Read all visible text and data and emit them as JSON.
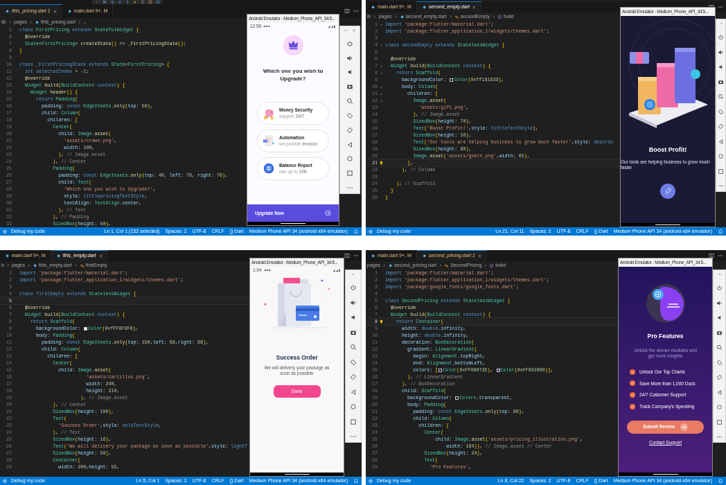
{
  "rows": [
    {
      "panels": [
        {
          "debug_toolbar": true,
          "tabs": [
            {
              "label": "firts_pricing.dart 1",
              "selected": true,
              "warning": true
            },
            {
              "label": "main.dart 9+, M",
              "selected": false,
              "warning": true
            }
          ],
          "breadcrumb": [
            {
              "label": "lib",
              "kind": "folder"
            },
            {
              "label": "pages",
              "kind": "folder"
            },
            {
              "label": "firts_pricing.dart",
              "kind": "file"
            },
            {
              "label": "...",
              "kind": "text"
            }
          ],
          "lines": [
            {
              "n": "5",
              "current": false,
              "text": "class FirstPricing extends StatefulWidget {"
            },
            {
              "n": "6",
              "current": false,
              "text": "  @override"
            },
            {
              "n": "7",
              "current": false,
              "text": "  State<FirstPricing> createState() => _FirstPricingState();"
            },
            {
              "n": "8",
              "current": false,
              "text": "}"
            },
            {
              "n": "9",
              "current": false
            },
            {
              "n": "10",
              "current": false,
              "text": "class _FirstPricingState extends State<FirstPricing> {"
            },
            {
              "n": "11",
              "current": false,
              "text": "  int selectedIndex = -1;"
            },
            {
              "n": "12",
              "current": false,
              "text": "  @override"
            },
            {
              "n": "13",
              "current": false,
              "text": "  Widget build(BuildContext context) {"
            },
            {
              "n": "14",
              "current": false,
              "text": "    Widget header() {"
            },
            {
              "n": "15",
              "current": false,
              "text": "      return Padding("
            },
            {
              "n": "16",
              "current": false,
              "text": "        padding: const EdgeInsets.only(top: 50),"
            },
            {
              "n": "17",
              "current": false,
              "text": "        child: Column("
            },
            {
              "n": "18",
              "current": false,
              "text": "          children: ["
            },
            {
              "n": "19",
              "current": false,
              "text": "            Center("
            },
            {
              "n": "20",
              "current": false,
              "text": "              child: Image.asset("
            },
            {
              "n": "21",
              "current": false,
              "text": "                'assets/crown.png',"
            },
            {
              "n": "22",
              "current": false,
              "text": "                width: 100,"
            },
            {
              "n": "23",
              "current": false,
              "text": "              ), // Image.asset"
            },
            {
              "n": "24",
              "current": false,
              "text": "            ), // Center"
            },
            {
              "n": "25",
              "current": false,
              "text": "            Padding("
            },
            {
              "n": "26",
              "current": false,
              "text": "              padding: const EdgeInsets.only(top: 40, left: 76, right: 76),"
            },
            {
              "n": "27",
              "current": false,
              "text": "              child: Text("
            },
            {
              "n": "28",
              "current": false,
              "text": "                'Which one you wish to Upgrade?',"
            },
            {
              "n": "29",
              "current": false,
              "text": "                style: tittlepricingTextStyle,"
            },
            {
              "n": "30",
              "current": false,
              "text": "                textAlign: TextAlign.center,"
            },
            {
              "n": "31",
              "current": false,
              "text": "              ), // Text"
            },
            {
              "n": "32",
              "current": false,
              "text": "            ), // Padding"
            },
            {
              "n": "33",
              "current": false,
              "text": "            SizedBox(height: 50),"
            }
          ],
          "status_bar": {
            "left": "Debug my code",
            "items": [
              "Ln 1, Col 1 (152 selected)",
              "Spaces: 2",
              "UTF-8",
              "CRLF",
              "{} Dart",
              "Medium Phone API 34 (android-x64 emulator)"
            ]
          },
          "emulator": {
            "title": "Android Emulator - Medium_Phone_API_34:5...",
            "screen": {
              "kind": "pricing",
              "time": "12:56",
              "heading": "Which one you wish to Upgrade?",
              "options": [
                {
                  "title": "Money Security",
                  "subtitle": "support **24/7**"
                },
                {
                  "title": "Automation",
                  "subtitle": "we provide **invoice**"
                },
                {
                  "title": "Balance Report",
                  "subtitle": "can up to **10K**"
                }
              ],
              "button": "Upgrade Now"
            }
          }
        },
        {
          "lightbulb": true,
          "tabs": [
            {
              "label": "main.dart 9+, M",
              "selected": false,
              "warning": true
            },
            {
              "label": "second_empty.dart",
              "selected": true,
              "warning": false
            }
          ],
          "breadcrumb": [
            {
              "label": "ib",
              "kind": "folder"
            },
            {
              "label": "pages",
              "kind": "folder"
            },
            {
              "label": "second_empty.dart",
              "kind": "file"
            },
            {
              "label": "secondEmpty",
              "kind": "class"
            },
            {
              "label": "build",
              "kind": "method"
            }
          ],
          "lines": [
            {
              "n": "1",
              "current": false,
              "fold": true,
              "text": "import 'package:flutter/material.dart';"
            },
            {
              "n": "2",
              "current": false,
              "fold": false,
              "text": "import 'package:flutter_application_1/widgets/themes.dart';"
            },
            {
              "n": "3",
              "current": false,
              "fold": false
            },
            {
              "n": "4",
              "current": false,
              "fold": true,
              "text": "class secondEmpty extends StatelessWidget {"
            },
            {
              "n": "5",
              "current": false,
              "fold": false
            },
            {
              "n": "6",
              "current": false,
              "fold": false,
              "text": "  @override"
            },
            {
              "n": "7",
              "current": false,
              "fold": true,
              "text": "  Widget build(BuildContext context) {"
            },
            {
              "n": "8",
              "current": false,
              "fold": true,
              "text": "    return Scaffold("
            },
            {
              "n": "9",
              "current": false,
              "fold": false,
              "parts": [
                {
                  "kind": "code",
                  "text": "      backgroundColor: "
                },
                {
                  "kind": "swatch",
                  "color": "#181833"
                },
                {
                  "kind": "code",
                  "text": "Color(0xff181833),"
                }
              ]
            },
            {
              "n": "10",
              "current": false,
              "fold": true,
              "text": "      body: Column("
            },
            {
              "n": "11",
              "current": false,
              "fold": true,
              "text": "        children: ["
            },
            {
              "n": "12",
              "current": false,
              "fold": true,
              "text": "          Image.asset("
            },
            {
              "n": "13",
              "current": false,
              "fold": false,
              "text": "            'assets/gift.png',"
            },
            {
              "n": "14",
              "current": false,
              "fold": false,
              "text": "          ), // Image.asset"
            },
            {
              "n": "15",
              "current": false,
              "fold": false,
              "text": "          SizedBox(height: 70),"
            },
            {
              "n": "16",
              "current": false,
              "fold": false,
              "text": "          Text('Boost Profit!',style: tittleTextStyle),"
            },
            {
              "n": "17",
              "current": false,
              "fold": false,
              "text": "          SizedBox(height: 16),"
            },
            {
              "n": "18",
              "current": false,
              "fold": false,
              "text": "          Text('Our tools are helping business to grow much faster',style: descrip"
            },
            {
              "n": "19",
              "current": false,
              "fold": false,
              "text": "          SizedBox(height: 60),"
            },
            {
              "n": "20",
              "current": false,
              "fold": false,
              "text": "          Image.asset('assets/gobtn.png',width: 65),"
            },
            {
              "n": "21",
              "current": true,
              "fold": false,
              "text": "        ],"
            },
            {
              "n": "22",
              "current": false,
              "fold": false,
              "text": "      ), // Column"
            },
            {
              "n": "23",
              "current": false,
              "fold": false
            },
            {
              "n": "24",
              "current": false,
              "fold": false,
              "text": "    ); // Scaffold"
            },
            {
              "n": "25",
              "current": false,
              "fold": false,
              "text": "  }"
            },
            {
              "n": "26",
              "current": false,
              "fold": false,
              "text": "}"
            }
          ],
          "status_bar": {
            "left": "Debug my code",
            "items": [
              "Ln 21, Col 11",
              "Spaces: 2",
              "UTF-8",
              "CRLF",
              "{} Dart",
              "Medium Phone API 34 (android-x64 emulator)"
            ]
          },
          "emulator": {
            "title": "Android Emulator - Medium_Phone_API_34:5...",
            "screen": {
              "kind": "boost",
              "title": "Boost Profit!",
              "description": "Our tools are helping business to grow much faster"
            }
          }
        }
      ]
    },
    {
      "panels": [
        {
          "lightbulb": false,
          "tabs": [
            {
              "label": "main.dart 9+, M",
              "selected": false,
              "warning": true
            },
            {
              "label": "firts_empty.dart",
              "selected": true,
              "warning": false
            }
          ],
          "breadcrumb": [
            {
              "label": "b",
              "kind": "folder"
            },
            {
              "label": "pages",
              "kind": "folder"
            },
            {
              "label": "firts_empty.dart",
              "kind": "file"
            },
            {
              "label": "firstEmpty",
              "kind": "class"
            }
          ],
          "lines": [
            {
              "n": "1",
              "current": false,
              "text": "import 'package:flutter/material.dart';"
            },
            {
              "n": "2",
              "current": false,
              "text": "import 'package:flutter_application_1/widgets/themes.dart';"
            },
            {
              "n": "3",
              "current": false
            },
            {
              "n": "4",
              "current": false,
              "text": "class firstEmpty extends StatelessWidget {"
            },
            {
              "n": "5",
              "current": true
            },
            {
              "n": "6",
              "current": false,
              "text": "  @override"
            },
            {
              "n": "7",
              "current": false,
              "text": "  Widget build(BuildContext context) {"
            },
            {
              "n": "8",
              "current": false,
              "text": "    return Scaffold("
            },
            {
              "n": "9",
              "current": false,
              "parts": [
                {
                  "kind": "code",
                  "text": "      backgroundColor: "
                },
                {
                  "kind": "swatch",
                  "color": "#f8f8f8"
                },
                {
                  "kind": "code",
                  "text": "Color(0xfFF8F8F8),"
                }
              ]
            },
            {
              "n": "10",
              "current": false,
              "text": "      body: Padding("
            },
            {
              "n": "11",
              "current": false,
              "text": "        padding: const EdgeInsets.only(top: 150,left: 68,right: 68),"
            },
            {
              "n": "12",
              "current": false,
              "text": "        child: Column("
            },
            {
              "n": "13",
              "current": false,
              "text": "          children: ["
            },
            {
              "n": "14",
              "current": false,
              "text": "            Center("
            },
            {
              "n": "15",
              "current": false,
              "text": "              child: Image.asset("
            },
            {
              "n": "16",
              "current": false,
              "text": "                        'assets/cartillus.png',"
            },
            {
              "n": "17",
              "current": false,
              "text": "                        width: 240,"
            },
            {
              "n": "18",
              "current": false,
              "text": "                        height: 210,"
            },
            {
              "n": "19",
              "current": false,
              "text": "                      ), // Image.asset"
            },
            {
              "n": "20",
              "current": false,
              "text": "            ), // Center"
            },
            {
              "n": "21",
              "current": false,
              "text": "            SizedBox(height: 100),"
            },
            {
              "n": "22",
              "current": false,
              "text": "            Text("
            },
            {
              "n": "23",
              "current": false,
              "text": "              'Success Order',style: boldTextStyle,"
            },
            {
              "n": "24",
              "current": false,
              "text": "            ), // Text"
            },
            {
              "n": "25",
              "current": false,
              "text": "            SizedBox(height: 16),"
            },
            {
              "n": "26",
              "current": false,
              "text": "            Text('We will delivery your package as soon as possible',style: lightT"
            },
            {
              "n": "27",
              "current": false,
              "text": "            SizedBox(height: 50),"
            },
            {
              "n": "28",
              "current": false,
              "text": "            Container("
            },
            {
              "n": "29",
              "current": false,
              "text": "              width: 200,height: 55,"
            }
          ],
          "status_bar": {
            "left": "Debug my code",
            "items": [
              "Ln 5, Col 1",
              "Spaces: 2",
              "UTF-8",
              "CRLF",
              "{} Dart",
              "Medium Phone API 34 (android-x64 emulator)"
            ]
          },
          "emulator": {
            "title": "Android Emulator - Medium_Phone_API_34:5...",
            "screen": {
              "kind": "success",
              "time": "1:04",
              "title": "Success Order",
              "description": "We will delivery your package as soon as possible",
              "button": "Done"
            }
          }
        },
        {
          "lightbulb": true,
          "tabs": [
            {
              "label": "main.dart 9+, M",
              "selected": false,
              "warning": true
            },
            {
              "label": "second_pricing.dart 1",
              "selected": true,
              "warning": true
            }
          ],
          "breadcrumb": [
            {
              "label": "pages",
              "kind": "folder"
            },
            {
              "label": "second_pricing.dart",
              "kind": "file"
            },
            {
              "label": "SecondPricing",
              "kind": "class"
            },
            {
              "label": "build",
              "kind": "method"
            }
          ],
          "lines": [
            {
              "n": "1",
              "current": false,
              "text": "import 'package:flutter/material.dart';"
            },
            {
              "n": "2",
              "current": false,
              "text": "import 'package:flutter_application_1/widgets/themes.dart';"
            },
            {
              "n": "3",
              "current": false,
              "text": "import 'package:google_fonts/google_fonts.dart';"
            },
            {
              "n": "4",
              "current": false
            },
            {
              "n": "5",
              "current": false,
              "text": "class SecondPricing extends StatelessWidget {"
            },
            {
              "n": "6",
              "current": false,
              "text": "  @override"
            },
            {
              "n": "7",
              "current": false,
              "text": "  Widget build(BuildContext context) {"
            },
            {
              "n": "8",
              "current": true,
              "text": "    return Container("
            },
            {
              "n": "9",
              "current": false,
              "text": "      width: double.infinity,"
            },
            {
              "n": "10",
              "current": false,
              "text": "      height: double.infinity,"
            },
            {
              "n": "11",
              "current": false,
              "text": "      decoration: BoxDecoration("
            },
            {
              "n": "12",
              "current": false,
              "text": "        gradient: LinearGradient("
            },
            {
              "n": "13",
              "current": false,
              "text": "          begin: Alignment.topRight,"
            },
            {
              "n": "14",
              "current": false,
              "text": "          end: Alignment.bottomLeft,"
            },
            {
              "n": "15",
              "current": false,
              "parts": [
                {
                  "kind": "code",
                  "text": "          colors: ["
                },
                {
                  "kind": "swatch",
                  "color": "#08073e"
                },
                {
                  "kind": "code",
                  "text": "Color(0xFF08073E), "
                },
                {
                  "kind": "swatch",
                  "color": "#602880"
                },
                {
                  "kind": "code",
                  "text": "Color(0xFF602880)],"
                }
              ]
            },
            {
              "n": "16",
              "current": false,
              "text": "        ), // LinearGradient"
            },
            {
              "n": "17",
              "current": false,
              "text": "      ), // BoxDecoration"
            },
            {
              "n": "18",
              "current": false,
              "text": "      child: Scaffold("
            },
            {
              "n": "19",
              "current": false,
              "parts": [
                {
                  "kind": "code",
                  "text": "        backgroundColor: "
                },
                {
                  "kind": "swatch"
                },
                {
                  "kind": "code",
                  "text": "Colors.transparent,"
                }
              ]
            },
            {
              "n": "20",
              "current": false,
              "text": "        body: Padding("
            },
            {
              "n": "21",
              "current": false,
              "text": "          padding: const EdgeInsets.only(top: 80),"
            },
            {
              "n": "22",
              "current": false,
              "text": "          child: Column("
            },
            {
              "n": "23",
              "current": false,
              "text": "            children: ["
            },
            {
              "n": "24",
              "current": false,
              "text": "              Center("
            },
            {
              "n": "25",
              "current": false,
              "text": "                  child: Image.asset('assets/pricing_illustration.png',"
            },
            {
              "n": "26",
              "current": false,
              "text": "                      width: 164)), // Image.asset // Center"
            },
            {
              "n": "27",
              "current": false,
              "text": "              SizedBox(height: 24),"
            },
            {
              "n": "28",
              "current": false,
              "text": "              Text("
            },
            {
              "n": "29",
              "current": false,
              "text": "                'Pro Features',"
            }
          ],
          "status_bar": {
            "left": "Debug my code",
            "items": [
              "Ln 8, Col 22",
              "Spaces: 2",
              "UTF-8",
              "CRLF",
              "{} Dart",
              "Medium Phone API 34 (android-x64 emulator)"
            ]
          },
          "emulator": {
            "title": "Android Emulator - Medium_Phone_API_34:5...",
            "screen": {
              "kind": "pro",
              "title": "Pro Features",
              "description": "Unlock the winner modules and get more insights",
              "features": [
                "Unlock Our Top Charts",
                "Save More than 1,000 Docs",
                "24/7 Customer Support",
                "Track Company's Spending"
              ],
              "button": "Submit Review",
              "link": "Contact Support"
            }
          }
        }
      ]
    }
  ]
}
